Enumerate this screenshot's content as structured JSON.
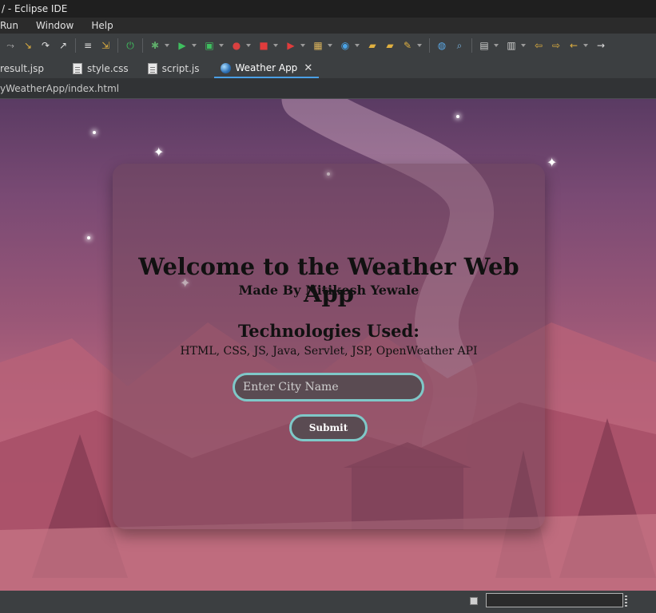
{
  "window": {
    "title": "/ - Eclipse IDE"
  },
  "menu": {
    "items": [
      "Run",
      "Window",
      "Help"
    ]
  },
  "toolbar": {
    "icons": [
      "skip-all-breakpoints-icon",
      "step-into-icon",
      "step-over-icon",
      "step-return-icon",
      "use-step-filters-icon",
      "drop-to-frame-icon",
      "power-icon",
      "debug-icon",
      "run-icon",
      "run-as-icon",
      "coverage-icon",
      "stop-icon",
      "external-tools-icon",
      "new-package-icon",
      "new-class-icon",
      "open-type-icon",
      "open-folder-icon",
      "pencil-icon",
      "globe-icon",
      "search-icon",
      "task-icon",
      "annotation-icon",
      "back-history-icon",
      "forward-history-icon",
      "back-icon",
      "forward-icon"
    ]
  },
  "tabs": [
    {
      "label": "result.jsp",
      "icon": "file-icon",
      "active": false
    },
    {
      "label": "style.css",
      "icon": "file-icon",
      "active": false
    },
    {
      "label": "script.js",
      "icon": "file-icon",
      "active": false
    },
    {
      "label": "Weather App",
      "icon": "globe-icon",
      "active": true
    }
  ],
  "browser": {
    "address": "yWeatherApp/index.html"
  },
  "page": {
    "heading": "Welcome to the Weather Web App",
    "subheading": "Made By Nitikesh Yewale",
    "tech_title": "Technologies Used:",
    "tech_list": "HTML, CSS, JS, Java, Servlet, JSP, OpenWeather API",
    "city_placeholder": "Enter City Name",
    "city_value": "",
    "submit_label": "Submit"
  },
  "colors": {
    "accent": "#4a9fe6",
    "input_border": "#7fc8c8",
    "input_bg": "#5a4b52"
  }
}
